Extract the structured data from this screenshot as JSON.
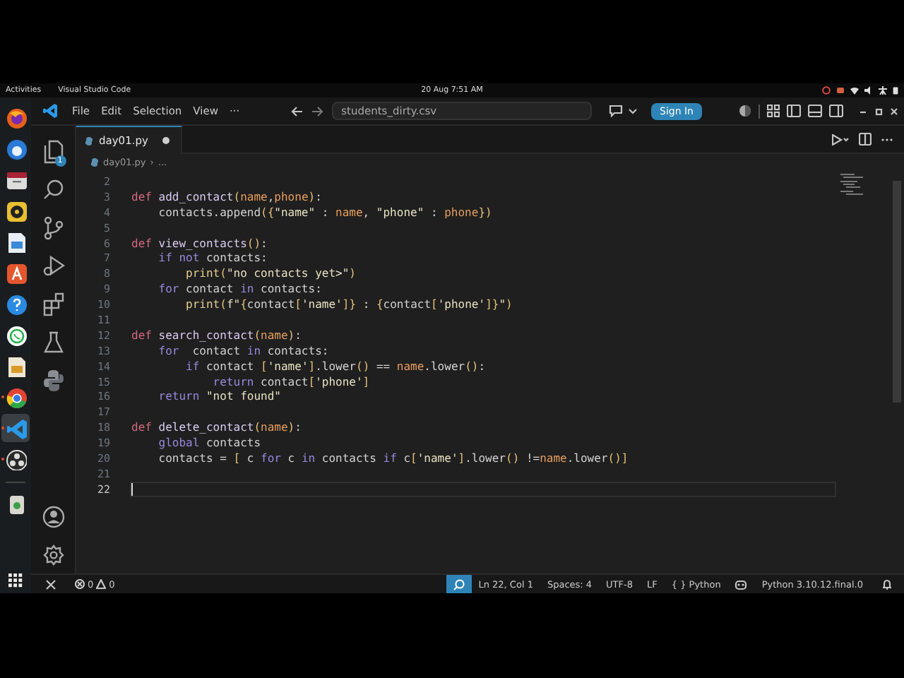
{
  "top_bar": {
    "activities": "Activities",
    "app_name": "Visual Studio Code",
    "clock": "20 Aug  7:51 AM"
  },
  "dock": [
    {
      "kind": "browser",
      "running": false,
      "selected": false
    },
    {
      "kind": "mail",
      "running": false,
      "selected": false
    },
    {
      "kind": "files",
      "running": false,
      "selected": false
    },
    {
      "kind": "music",
      "running": false,
      "selected": false
    },
    {
      "kind": "document",
      "running": false,
      "selected": false
    },
    {
      "kind": "store",
      "running": false,
      "selected": false
    },
    {
      "kind": "help",
      "running": false,
      "selected": false
    },
    {
      "kind": "chat",
      "running": false,
      "selected": false
    },
    {
      "kind": "slides",
      "running": false,
      "selected": false
    },
    {
      "kind": "chrome",
      "running": true,
      "selected": false
    },
    {
      "kind": "code",
      "running": true,
      "selected": true
    },
    {
      "kind": "record",
      "running": true,
      "selected": false
    },
    {
      "kind": "trash",
      "running": false,
      "selected": false
    }
  ],
  "window": {
    "menu": [
      "File",
      "Edit",
      "Selection",
      "View",
      "···"
    ],
    "command_center": "students_dirty.csv",
    "sign_in": "Sign In"
  },
  "activity_bar": {
    "explorer_badge": "1"
  },
  "tabs": [
    {
      "label": "day01.py",
      "modified": true,
      "selected": true
    }
  ],
  "breadcrumb": [
    "day01.py",
    "›",
    "..."
  ],
  "editor": {
    "lines": [
      {
        "number": "2",
        "current": false
      },
      {
        "number": "3",
        "current": false,
        "tokens": [
          {
            "kind": "keyword",
            "text": "def"
          },
          {
            "kind": "function",
            "text": " add_contact"
          },
          {
            "kind": "bracket",
            "text": "("
          },
          {
            "kind": "param",
            "text": "name"
          },
          {
            "kind": "plain",
            "text": ","
          },
          {
            "kind": "param",
            "text": "phone"
          },
          {
            "kind": "bracket",
            "text": ")"
          },
          {
            "kind": "plain",
            "text": ":"
          }
        ]
      },
      {
        "number": "4",
        "current": false,
        "tokens": [
          {
            "kind": "plain",
            "text": "    contacts.append"
          },
          {
            "kind": "bracket",
            "text": "({"
          },
          {
            "kind": "string",
            "text": "\"name\""
          },
          {
            "kind": "plain",
            "text": " : "
          },
          {
            "kind": "param",
            "text": "name"
          },
          {
            "kind": "plain",
            "text": ", "
          },
          {
            "kind": "string",
            "text": "\"phone\""
          },
          {
            "kind": "plain",
            "text": " : "
          },
          {
            "kind": "param",
            "text": "phone"
          },
          {
            "kind": "bracket",
            "text": "})"
          }
        ]
      },
      {
        "number": "5",
        "current": false
      },
      {
        "number": "6",
        "current": false,
        "tokens": [
          {
            "kind": "keyword",
            "text": "def"
          },
          {
            "kind": "function",
            "text": " view_contacts"
          },
          {
            "kind": "bracket",
            "text": "()"
          },
          {
            "kind": "plain",
            "text": ":"
          }
        ]
      },
      {
        "number": "7",
        "current": false,
        "tokens": [
          {
            "kind": "control",
            "text": "    if not"
          },
          {
            "kind": "plain",
            "text": " contacts:"
          }
        ]
      },
      {
        "number": "8",
        "current": false,
        "tokens": [
          {
            "kind": "call",
            "text": "        print"
          },
          {
            "kind": "bracket",
            "text": "("
          },
          {
            "kind": "string",
            "text": "\"no contacts yet>\""
          },
          {
            "kind": "bracket",
            "text": ")"
          }
        ]
      },
      {
        "number": "9",
        "current": false,
        "tokens": [
          {
            "kind": "control",
            "text": "    for"
          },
          {
            "kind": "plain",
            "text": " contact "
          },
          {
            "kind": "control",
            "text": "in"
          },
          {
            "kind": "plain",
            "text": " contacts:"
          }
        ]
      },
      {
        "number": "10",
        "current": false,
        "tokens": [
          {
            "kind": "call",
            "text": "        print"
          },
          {
            "kind": "bracket",
            "text": "("
          },
          {
            "kind": "string",
            "text": "f\""
          },
          {
            "kind": "bracket",
            "text": "{"
          },
          {
            "kind": "plain",
            "text": "contact"
          },
          {
            "kind": "bracket",
            "text": "["
          },
          {
            "kind": "string",
            "text": "'name'"
          },
          {
            "kind": "bracket",
            "text": "]}"
          },
          {
            "kind": "string",
            "text": " : "
          },
          {
            "kind": "bracket",
            "text": "{"
          },
          {
            "kind": "plain",
            "text": "contact"
          },
          {
            "kind": "bracket",
            "text": "["
          },
          {
            "kind": "string",
            "text": "'phone'"
          },
          {
            "kind": "bracket",
            "text": "]}"
          },
          {
            "kind": "string",
            "text": "\""
          },
          {
            "kind": "bracket",
            "text": ")"
          }
        ]
      },
      {
        "number": "11",
        "current": false
      },
      {
        "number": "12",
        "current": false,
        "tokens": [
          {
            "kind": "keyword",
            "text": "def"
          },
          {
            "kind": "function",
            "text": " search_contact"
          },
          {
            "kind": "bracket",
            "text": "("
          },
          {
            "kind": "param",
            "text": "name"
          },
          {
            "kind": "bracket",
            "text": ")"
          },
          {
            "kind": "plain",
            "text": ":"
          }
        ]
      },
      {
        "number": "13",
        "current": false,
        "tokens": [
          {
            "kind": "control",
            "text": "    for"
          },
          {
            "kind": "plain",
            "text": "  contact "
          },
          {
            "kind": "control",
            "text": "in"
          },
          {
            "kind": "plain",
            "text": " contacts:"
          }
        ]
      },
      {
        "number": "14",
        "current": false,
        "tokens": [
          {
            "kind": "control",
            "text": "        if"
          },
          {
            "kind": "plain",
            "text": " contact "
          },
          {
            "kind": "bracket",
            "text": "["
          },
          {
            "kind": "string",
            "text": "'name'"
          },
          {
            "kind": "bracket",
            "text": "]"
          },
          {
            "kind": "plain",
            "text": ".lower"
          },
          {
            "kind": "bracket",
            "text": "()"
          },
          {
            "kind": "plain",
            "text": " == "
          },
          {
            "kind": "param",
            "text": "name"
          },
          {
            "kind": "plain",
            "text": ".lower"
          },
          {
            "kind": "bracket",
            "text": "()"
          },
          {
            "kind": "plain",
            "text": ":"
          }
        ]
      },
      {
        "number": "15",
        "current": false,
        "tokens": [
          {
            "kind": "control",
            "text": "            return"
          },
          {
            "kind": "plain",
            "text": " contact"
          },
          {
            "kind": "bracket",
            "text": "["
          },
          {
            "kind": "string",
            "text": "'phone'"
          },
          {
            "kind": "bracket",
            "text": "]"
          }
        ]
      },
      {
        "number": "16",
        "current": false,
        "tokens": [
          {
            "kind": "control",
            "text": "    return"
          },
          {
            "kind": "string",
            "text": " \"not found\""
          }
        ]
      },
      {
        "number": "17",
        "current": false
      },
      {
        "number": "18",
        "current": false,
        "tokens": [
          {
            "kind": "keyword",
            "text": "def"
          },
          {
            "kind": "function",
            "text": " delete_contact"
          },
          {
            "kind": "bracket",
            "text": "("
          },
          {
            "kind": "param",
            "text": "name"
          },
          {
            "kind": "bracket",
            "text": ")"
          },
          {
            "kind": "plain",
            "text": ":"
          }
        ]
      },
      {
        "number": "19",
        "current": false,
        "tokens": [
          {
            "kind": "control",
            "text": "    global"
          },
          {
            "kind": "plain",
            "text": " contacts"
          }
        ]
      },
      {
        "number": "20",
        "current": false,
        "tokens": [
          {
            "kind": "plain",
            "text": "    contacts = "
          },
          {
            "kind": "bracket",
            "text": "["
          },
          {
            "kind": "plain",
            "text": " c "
          },
          {
            "kind": "control",
            "text": "for"
          },
          {
            "kind": "plain",
            "text": " c "
          },
          {
            "kind": "control",
            "text": "in"
          },
          {
            "kind": "plain",
            "text": " contacts "
          },
          {
            "kind": "control",
            "text": "if"
          },
          {
            "kind": "plain",
            "text": " c"
          },
          {
            "kind": "bracket",
            "text": "["
          },
          {
            "kind": "string",
            "text": "'name'"
          },
          {
            "kind": "bracket",
            "text": "]"
          },
          {
            "kind": "plain",
            "text": ".lower"
          },
          {
            "kind": "bracket",
            "text": "()"
          },
          {
            "kind": "plain",
            "text": " !="
          },
          {
            "kind": "param",
            "text": "name"
          },
          {
            "kind": "plain",
            "text": ".lower"
          },
          {
            "kind": "bracket",
            "text": "()"
          },
          {
            "kind": "bracket",
            "text": "]"
          }
        ]
      },
      {
        "number": "21",
        "current": false
      },
      {
        "number": "22",
        "current": true
      }
    ]
  },
  "status_bar": {
    "errors": "0",
    "warnings": "0",
    "position": "Ln 22, Col 1",
    "indent": "Spaces: 4",
    "encoding": "UTF-8",
    "eol": "LF",
    "language": "{ } Python",
    "interpreter": "Python 3.10.12.final.0"
  }
}
